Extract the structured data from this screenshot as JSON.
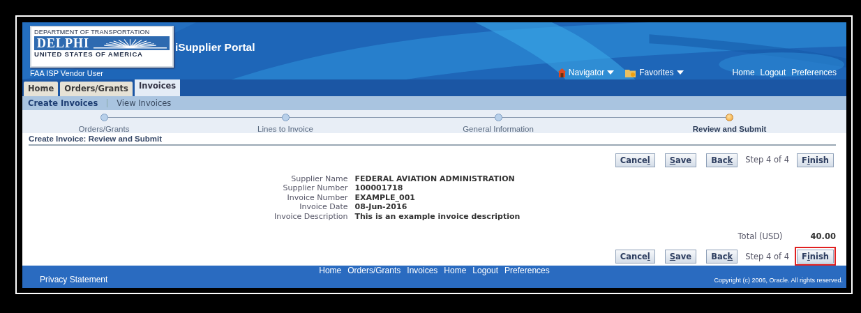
{
  "header": {
    "logo": {
      "top": "DEPARTMENT OF TRANSPORTATION",
      "name": "DELPHI",
      "bottom": "UNITED STATES OF AMERICA"
    },
    "app_title": "iSupplier Portal",
    "user": "FAA ISP Vendor User",
    "menus": [
      {
        "label": "Navigator",
        "kind": "home"
      },
      {
        "label": "Favorites",
        "kind": "folder"
      }
    ],
    "links": [
      "Home",
      "Logout",
      "Preferences"
    ]
  },
  "tabs": [
    {
      "label": "Home",
      "selected": false
    },
    {
      "label": "Orders/Grants",
      "selected": false
    },
    {
      "label": "Invoices",
      "selected": true
    }
  ],
  "subtabs": [
    {
      "label": "Create Invoices",
      "selected": true
    },
    {
      "label": "View Invoices",
      "selected": false
    }
  ],
  "train": [
    {
      "label": "Orders/Grants",
      "selected": false
    },
    {
      "label": "Lines to Invoice",
      "selected": false
    },
    {
      "label": "General Information",
      "selected": false
    },
    {
      "label": "Review and Submit",
      "selected": true
    }
  ],
  "page_title": "Create Invoice: Review and Submit",
  "top_actions": {
    "buttons": [
      {
        "before": "Cance",
        "key": "l",
        "highlighted": false
      },
      {
        "key": "S",
        "after": "ave",
        "highlighted": false
      },
      {
        "before": "Bac",
        "key": "k",
        "highlighted": false
      }
    ],
    "step": "Step 4 of 4",
    "finish": {
      "before": "F",
      "key": "i",
      "after": "nish",
      "highlighted": false
    }
  },
  "details": [
    {
      "label": "Supplier Name",
      "value": "FEDERAL AVIATION ADMINISTRATION"
    },
    {
      "label": "Supplier Number",
      "value": "100001718"
    },
    {
      "label": "Invoice Number",
      "value": "EXAMPLE_001"
    },
    {
      "label": "Invoice Date",
      "value": "08-Jun-2016"
    },
    {
      "label": "Invoice Description",
      "value": "This is an example invoice description"
    }
  ],
  "total": {
    "label": "Total (USD)",
    "value": "40.00"
  },
  "bottom_actions": {
    "buttons": [
      {
        "before": "Cance",
        "key": "l",
        "highlighted": false
      },
      {
        "key": "S",
        "after": "ave",
        "highlighted": false
      },
      {
        "before": "Bac",
        "key": "k",
        "highlighted": false
      }
    ],
    "step": "Step 4 of 4",
    "finish": {
      "before": "F",
      "key": "i",
      "after": "nish",
      "highlighted": true
    }
  },
  "footer": {
    "links": [
      "Home",
      "Orders/Grants",
      "Invoices",
      "Home",
      "Logout",
      "Preferences"
    ],
    "privacy": "Privacy Statement",
    "copyright": "Copyright (c) 2006, Oracle. All rights reserved."
  }
}
